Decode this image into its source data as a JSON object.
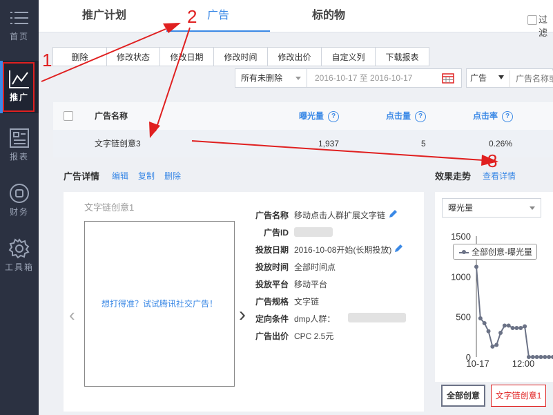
{
  "sidebar": {
    "items": [
      {
        "label": "首页",
        "icon": "menu-icon"
      },
      {
        "label": "推广",
        "icon": "line-chart-icon"
      },
      {
        "label": "报表",
        "icon": "report-icon"
      },
      {
        "label": "财务",
        "icon": "finance-icon"
      },
      {
        "label": "工具箱",
        "icon": "gear-icon"
      }
    ]
  },
  "tabs": [
    "推广计划",
    "广告",
    "标的物"
  ],
  "filter_checkbox_label": "过滤",
  "toolbar": [
    "删除",
    "修改状态",
    "修改日期",
    "修改时间",
    "修改出价",
    "自定义列",
    "下载报表"
  ],
  "filters": {
    "status": "所有未删除",
    "date_range": "2016-10-17 至 2016-10-17",
    "type": "广告",
    "search_placeholder": "广告名称或"
  },
  "table": {
    "headers": [
      "广告名称",
      "曝光量",
      "点击量",
      "点击率"
    ],
    "rows": [
      {
        "name": "文字链创意3",
        "impressions": "1,937",
        "clicks": "5",
        "ctr": "0.26%"
      }
    ]
  },
  "detail": {
    "title": "广告详情",
    "actions": [
      "编辑",
      "复制",
      "删除"
    ],
    "preview_title": "文字链创意1",
    "preview_text": "想打得准？试试腾讯社交广告！",
    "fields": [
      {
        "key": "广告名称",
        "value": "移动点击人群扩展文字链"
      },
      {
        "key": "广告ID",
        "value": ""
      },
      {
        "key": "投放日期",
        "value": "2016-10-08开始(长期投放)"
      },
      {
        "key": "投放时间",
        "value": "全部时间点"
      },
      {
        "key": "投放平台",
        "value": "移动平台"
      },
      {
        "key": "广告规格",
        "value": "文字链"
      },
      {
        "key": "定向条件",
        "value": "dmp人群："
      },
      {
        "key": "广告出价",
        "value": "CPC 2.5元"
      }
    ]
  },
  "trend": {
    "title": "效果走势",
    "link": "查看详情",
    "metric": "曝光量",
    "legend": "全部创意-曝光量",
    "buttons": [
      "全部创意",
      "文字链创意1"
    ]
  },
  "annotations": [
    "1",
    "2",
    "3"
  ],
  "colors": {
    "accent": "#3b89e6",
    "annotation": "#e02020",
    "sidebar": "#2b3141"
  },
  "chart_data": {
    "type": "line",
    "series": [
      {
        "name": "全部创意-曝光量",
        "values": [
          1120,
          480,
          420,
          320,
          130,
          150,
          300,
          390,
          390,
          360,
          360,
          360,
          380,
          0,
          0,
          0,
          0,
          0,
          0,
          0
        ]
      }
    ],
    "x_ticks": [
      "10-17",
      "12:00"
    ],
    "y_ticks": [
      "0",
      "500",
      "1000",
      "1500"
    ],
    "ylim": [
      0,
      1500
    ]
  }
}
